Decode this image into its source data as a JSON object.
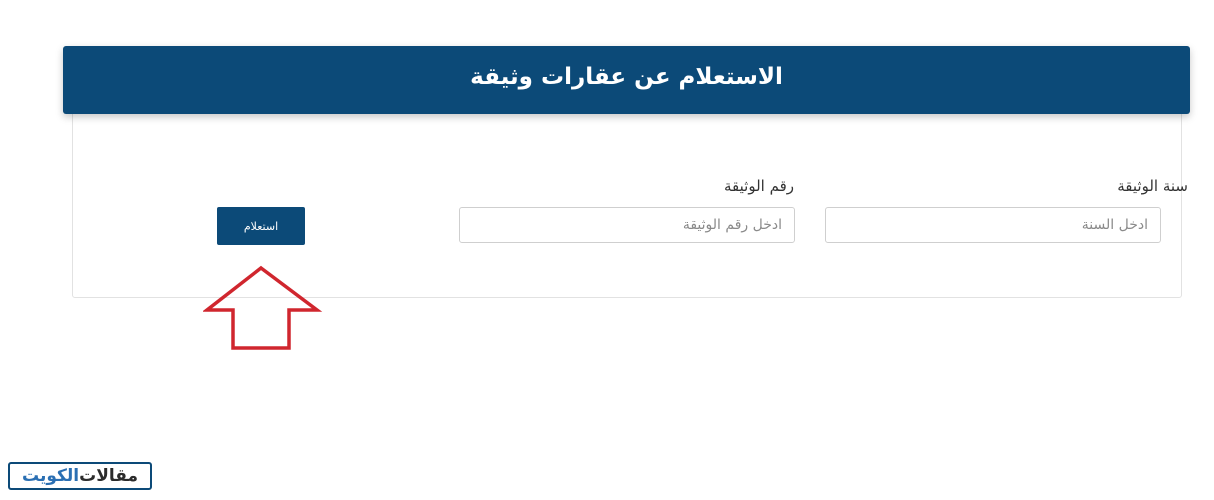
{
  "header": {
    "title": "الاستعلام عن عقارات وثيقة"
  },
  "form": {
    "year": {
      "label": "سنة الوثيقة",
      "placeholder": "ادخل السنة",
      "value": ""
    },
    "document_number": {
      "label": "رقم الوثيقة",
      "placeholder": "ادخل رقم الوثيقة",
      "value": ""
    },
    "submit_label": "استعلام"
  },
  "annotation": {
    "arrow_color": "#d0262e"
  },
  "watermark": {
    "part1": "مقالات",
    "part2": "الكويت"
  },
  "colors": {
    "primary": "#0c4a78"
  }
}
